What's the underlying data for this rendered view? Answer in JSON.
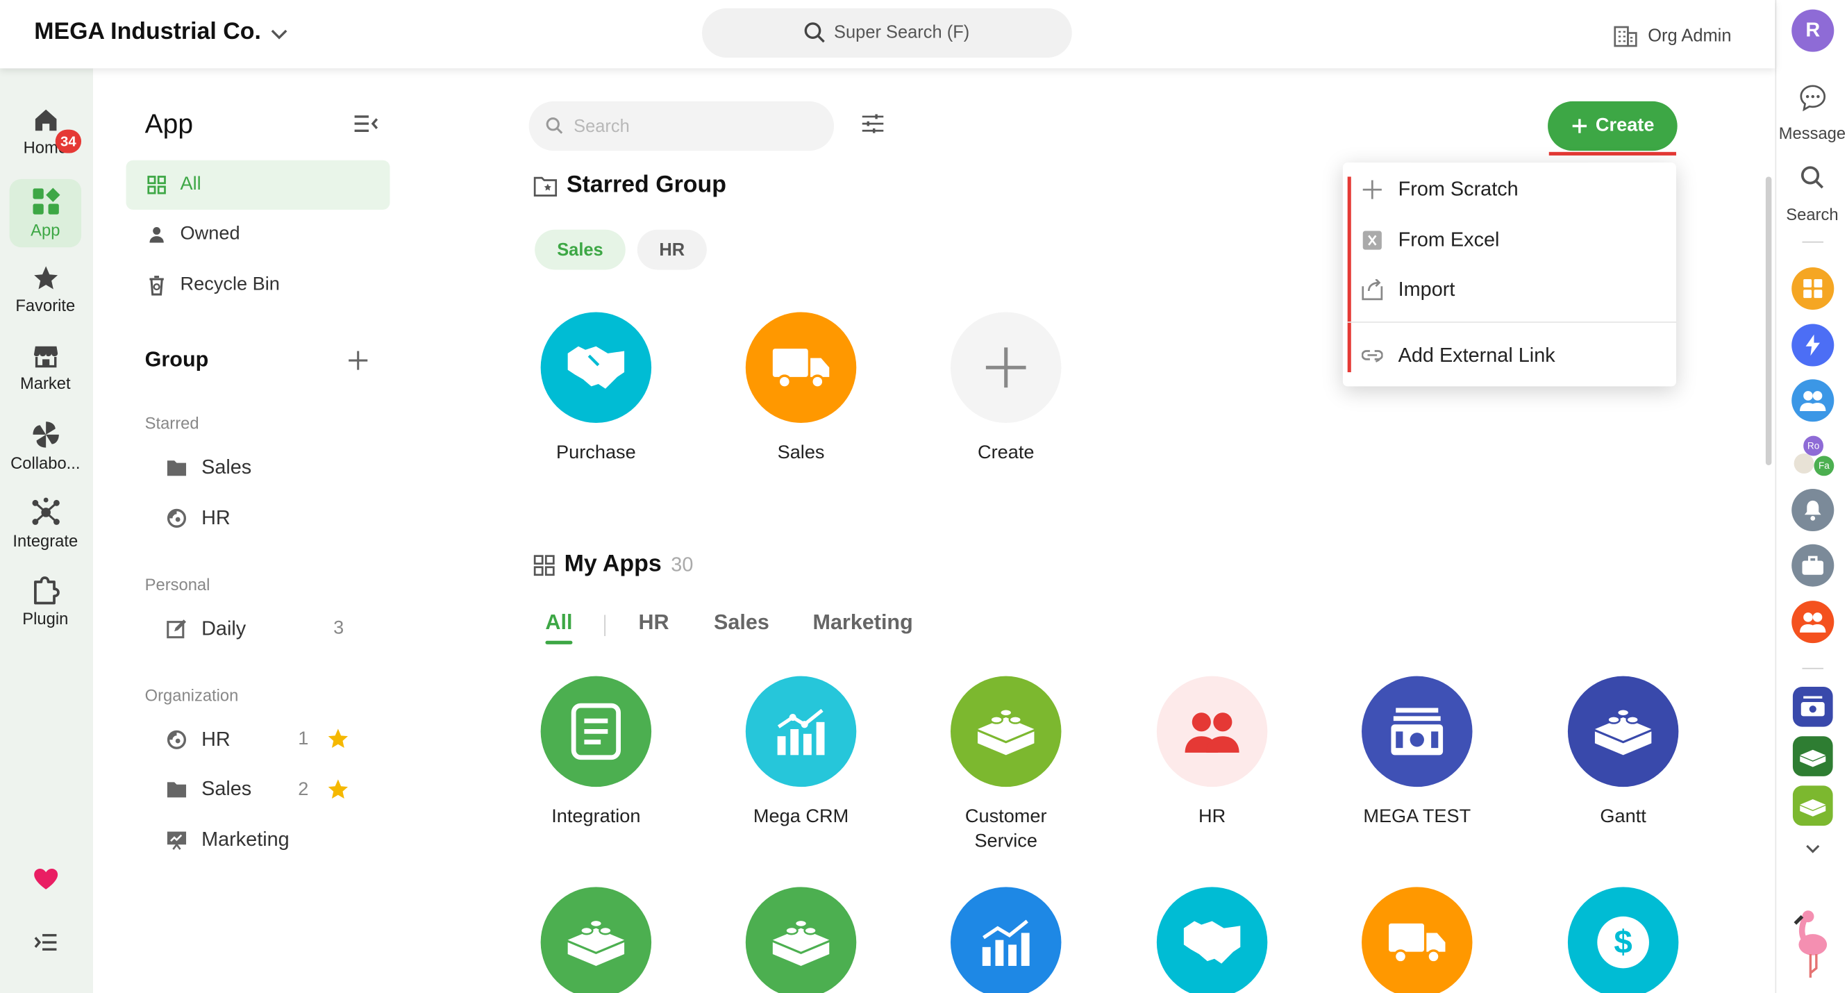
{
  "header": {
    "org_name": "MEGA Industrial Co.",
    "super_search": "Super Search (F)",
    "org_admin": "Org Admin",
    "avatar_letter": "R"
  },
  "left_nav": {
    "items": [
      {
        "label": "Home",
        "badge": "34"
      },
      {
        "label": "App"
      },
      {
        "label": "Favorite"
      },
      {
        "label": "Market"
      },
      {
        "label": "Collabo..."
      },
      {
        "label": "Integrate"
      },
      {
        "label": "Plugin"
      }
    ]
  },
  "sidebar": {
    "title": "App",
    "items": [
      {
        "label": "All"
      },
      {
        "label": "Owned"
      },
      {
        "label": "Recycle Bin"
      }
    ],
    "group_heading": "Group",
    "sections": {
      "starred": {
        "label": "Starred",
        "items": [
          {
            "label": "Sales"
          },
          {
            "label": "HR"
          }
        ]
      },
      "personal": {
        "label": "Personal",
        "items": [
          {
            "label": "Daily",
            "count": "3"
          }
        ]
      },
      "organization": {
        "label": "Organization",
        "items": [
          {
            "label": "HR",
            "count": "1"
          },
          {
            "label": "Sales",
            "count": "2"
          },
          {
            "label": "Marketing"
          }
        ]
      }
    }
  },
  "main": {
    "search_placeholder": "Search",
    "create_label": "Create",
    "starred_group": {
      "heading": "Starred Group",
      "chips": [
        "Sales",
        "HR"
      ],
      "tiles": [
        {
          "label": "Purchase"
        },
        {
          "label": "Sales"
        },
        {
          "label": "Create"
        }
      ]
    },
    "my_apps": {
      "heading": "My Apps",
      "count": "30",
      "tabs": [
        "All",
        "HR",
        "Sales",
        "Marketing"
      ],
      "tiles": [
        {
          "label": "Integration"
        },
        {
          "label": "Mega CRM"
        },
        {
          "label": "Customer Service"
        },
        {
          "label": "HR"
        },
        {
          "label": "MEGA TEST"
        },
        {
          "label": "Gantt"
        }
      ]
    }
  },
  "dropdown": {
    "items": [
      {
        "label": "From Scratch"
      },
      {
        "label": "From Excel"
      },
      {
        "label": "Import"
      },
      {
        "label": "Add External Link"
      }
    ]
  },
  "right_rail": {
    "message_label": "Message",
    "search_label": "Search",
    "avatar_initials": [
      "Ro",
      "Fa"
    ]
  },
  "colors": {
    "brand_green": "#3da745",
    "badge_red": "#e53935",
    "teal": "#00bcd4",
    "orange": "#ff9800",
    "indigo": "#3f51b5",
    "lime": "#7cb82f"
  }
}
